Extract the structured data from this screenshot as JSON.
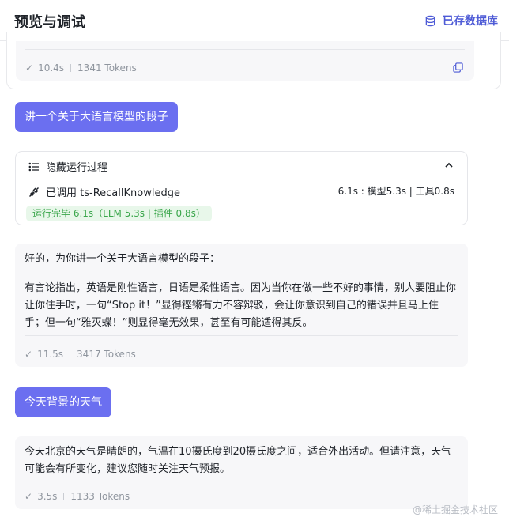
{
  "header": {
    "title": "预览与调试",
    "saved_label": "已存数据库"
  },
  "prev_message": {
    "time": "10.4s",
    "tokens": "1341 Tokens"
  },
  "user_messages": [
    "讲一个关于大语言模型的段子",
    "今天背景的天气"
  ],
  "run": {
    "toggle_label": "隐藏运行过程",
    "tool_label": "已调用 ts-RecallKnowledge",
    "tool_timing": "6.1s : 模型5.3s | 工具0.8s",
    "status": "运行完毕 6.1s（LLM 5.3s | 插件 0.8s）"
  },
  "answers": [
    {
      "intro": "好的，为你讲一个关于大语言模型的段子：",
      "body": "有言论指出，英语是刚性语言，日语是柔性语言。因为当你在做一些不好的事情，别人要阻止你让你住手时，一句“Stop it！”显得铿锵有力不容辩驳，会让你意识到自己的错误并且马上住手；但一句“雅灭蝶！”则显得毫无效果，甚至有可能适得其反。",
      "time": "11.5s",
      "tokens": "3417 Tokens"
    },
    {
      "body": "今天北京的天气是晴朗的，气温在10摄氏度到20摄氏度之间，适合外出活动。但请注意，天气可能会有所变化，建议您随时关注天气预报。",
      "time": "3.5s",
      "tokens": "1133 Tokens"
    }
  ],
  "watermark": "@稀土掘金技术社区",
  "icons": {
    "saved": "database-icon",
    "copy": "copy-icon",
    "toggle": "list-icon",
    "collapse": "chevron-up-icon",
    "tool": "plug-icon",
    "check": "check-icon"
  },
  "colors": {
    "accent": "#4e5bd6",
    "user_bubble": "#6b6ff0",
    "success_bg": "#e8f7ea",
    "success_text": "#3aa64b"
  }
}
